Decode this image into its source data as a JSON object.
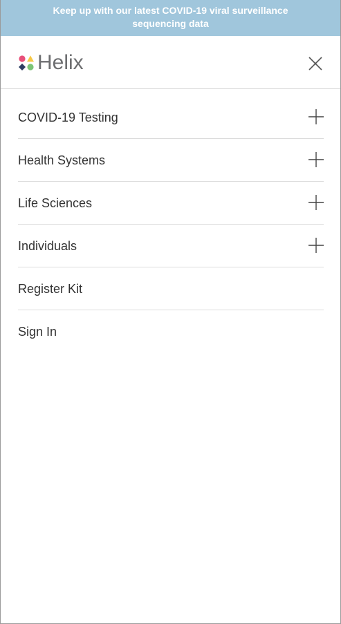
{
  "banner": {
    "text": "Keep up with our latest COVID-19 viral surveillance sequencing data"
  },
  "header": {
    "logo_text": "Helix",
    "logo_colors": {
      "pink": "#e8507a",
      "yellow": "#f7c948",
      "navy": "#2d3e63",
      "green": "#7cc576"
    },
    "close_icon": "close-icon"
  },
  "menu": {
    "items": [
      {
        "label": "COVID-19 Testing",
        "expandable": true,
        "icon": "plus-icon"
      },
      {
        "label": "Health Systems",
        "expandable": true,
        "icon": "plus-icon"
      },
      {
        "label": "Life Sciences",
        "expandable": true,
        "icon": "plus-icon"
      },
      {
        "label": "Individuals",
        "expandable": true,
        "icon": "plus-icon"
      },
      {
        "label": "Register Kit",
        "expandable": false
      },
      {
        "label": "Sign In",
        "expandable": false
      }
    ]
  },
  "colors": {
    "banner_bg": "#a0c6dc",
    "text": "#333333",
    "divider": "#dcdcdc"
  }
}
